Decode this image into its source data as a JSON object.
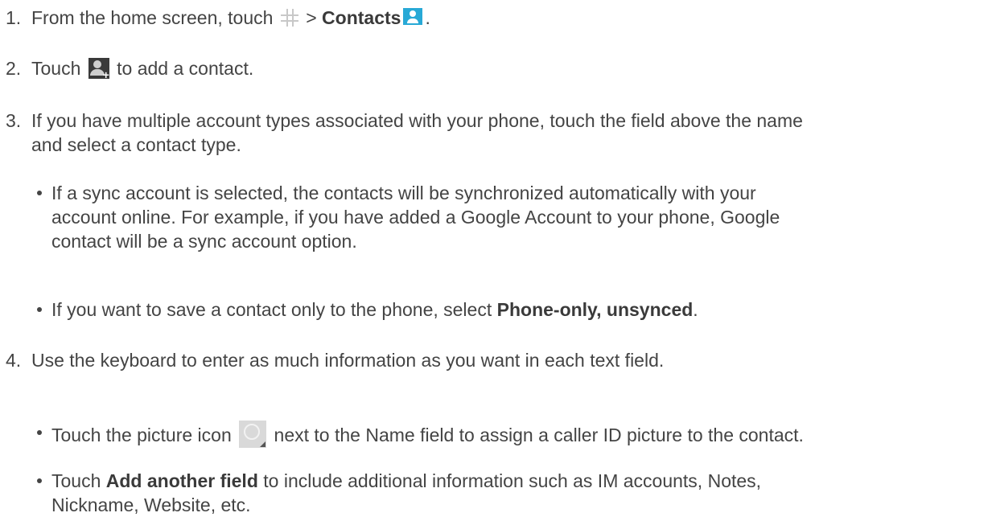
{
  "steps": [
    {
      "number": "1.",
      "before_grid": "From the home screen, touch ",
      "after_grid": " > ",
      "bold": "Contacts",
      "after_icon": ".",
      "icons": [
        "apps-grid-icon",
        "contacts-app-icon"
      ]
    },
    {
      "number": "2.",
      "before_icon": "Touch ",
      "after_icon": " to add a contact.",
      "icons": [
        "add-contact-icon"
      ]
    },
    {
      "number": "3.",
      "line1": "If you have multiple account types associated with your phone, touch the field above the name",
      "line2": "and select a contact type.",
      "bullets": [
        {
          "line1": "If a sync account is selected, the contacts will be synchronized automatically with your",
          "line2": "account online. For example, if you have added a Google Account to your phone, Google",
          "line3": "contact will be a sync account option."
        },
        {
          "before_bold": "If you want to save a contact only to the phone, select ",
          "bold": "Phone-only, unsynced",
          "after_bold": "."
        }
      ]
    },
    {
      "number": "4.",
      "text": "Use the keyboard to enter as much information as you want in each text field.",
      "bullets": [
        {
          "before_icon": "Touch the picture icon ",
          "after_icon": " next to the Name field to assign a caller ID picture to the contact.",
          "icons": [
            "picture-icon"
          ]
        },
        {
          "before_bold": "Touch ",
          "bold": "Add another field",
          "after_bold": " to include additional information such as IM accounts, Notes,",
          "line2": "Nickname, Website, etc."
        }
      ]
    }
  ],
  "colors": {
    "text": "#444444",
    "contacts_icon": "#28a9d6",
    "add_contact_icon": "#3a3a3a",
    "picture_icon": "#d9d9d9"
  }
}
